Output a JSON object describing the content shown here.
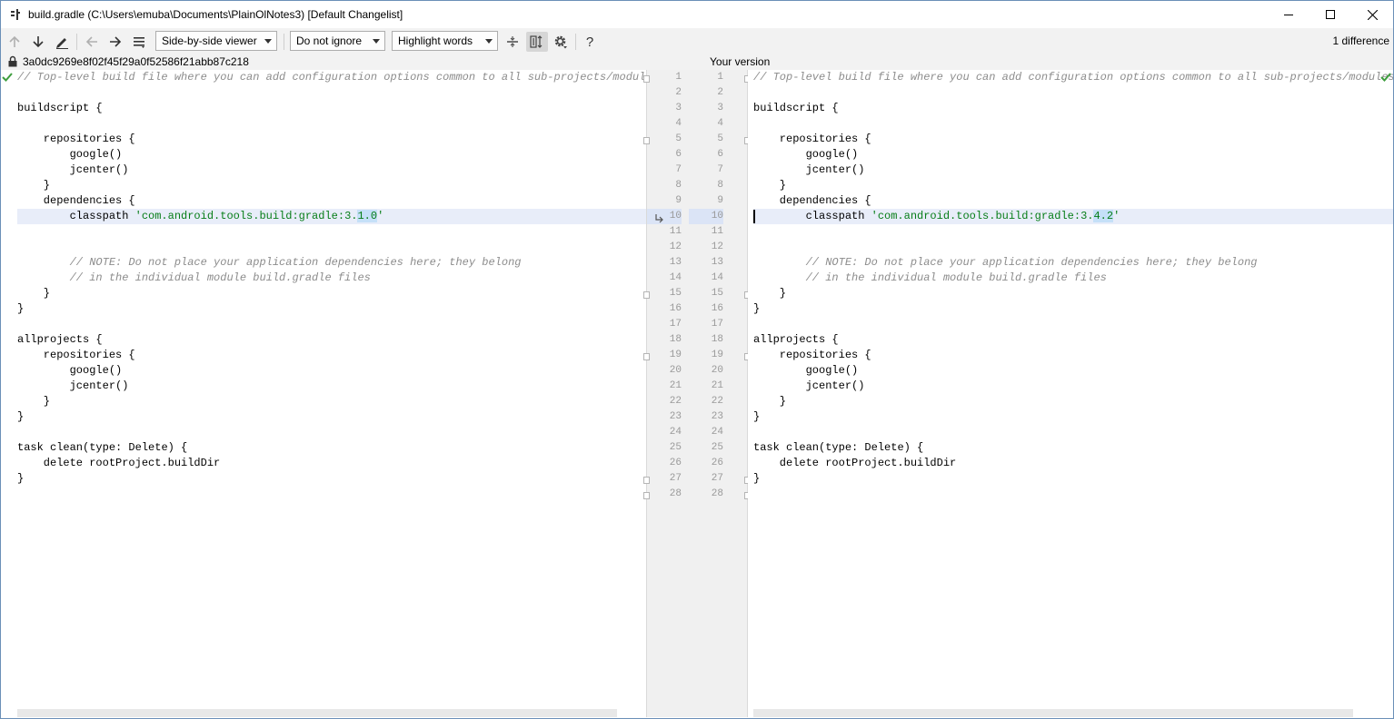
{
  "window": {
    "title": "build.gradle (C:\\Users\\emuba\\Documents\\PlainOlNotes3) [Default Changelist]",
    "minimize_icon": "minimize-icon",
    "maximize_icon": "maximize-icon",
    "close_icon": "close-icon"
  },
  "toolbar": {
    "viewer_select": "Side-by-side viewer",
    "ignore_select": "Do not ignore",
    "highlight_select": "Highlight words",
    "help_label": "?",
    "difference_count": "1 difference"
  },
  "header": {
    "left_revision": "3a0dc9269e8f02f45f29a0f52586f21abb87c218",
    "right_title": "Your version"
  },
  "left_code": [
    {
      "type": "comment",
      "text": "// Top-level build file where you can add configuration options common to all sub-projects/modules."
    },
    {
      "type": "plain",
      "text": ""
    },
    {
      "type": "plain",
      "text": "buildscript {"
    },
    {
      "type": "plain",
      "text": ""
    },
    {
      "type": "plain",
      "text": "    repositories {"
    },
    {
      "type": "plain",
      "text": "        google()"
    },
    {
      "type": "plain",
      "text": "        jcenter()"
    },
    {
      "type": "plain",
      "text": "    }"
    },
    {
      "type": "plain",
      "text": "    dependencies {"
    },
    {
      "type": "changed",
      "pre": "        classpath ",
      "str_pre": "'com.android.tools.build:gradle:3.",
      "str_chg": "1.0",
      "str_post": "'"
    },
    {
      "type": "plain",
      "text": ""
    },
    {
      "type": "plain",
      "text": ""
    },
    {
      "type": "comment",
      "text": "        // NOTE: Do not place your application dependencies here; they belong"
    },
    {
      "type": "comment",
      "text": "        // in the individual module build.gradle files"
    },
    {
      "type": "plain",
      "text": "    }"
    },
    {
      "type": "plain",
      "text": "}"
    },
    {
      "type": "plain",
      "text": ""
    },
    {
      "type": "plain",
      "text": "allprojects {"
    },
    {
      "type": "plain",
      "text": "    repositories {"
    },
    {
      "type": "plain",
      "text": "        google()"
    },
    {
      "type": "plain",
      "text": "        jcenter()"
    },
    {
      "type": "plain",
      "text": "    }"
    },
    {
      "type": "plain",
      "text": "}"
    },
    {
      "type": "plain",
      "text": ""
    },
    {
      "type": "task",
      "pre": "task clean(",
      "kw": "type",
      "post": ": Delete) {"
    },
    {
      "type": "plain",
      "text": "    delete rootProject.buildDir"
    },
    {
      "type": "plain",
      "text": "}"
    },
    {
      "type": "plain",
      "text": ""
    }
  ],
  "right_code": [
    {
      "type": "comment",
      "text": "// Top-level build file where you can add configuration options common to all sub-projects/modules."
    },
    {
      "type": "plain",
      "text": ""
    },
    {
      "type": "plain",
      "text": "buildscript {"
    },
    {
      "type": "plain",
      "text": ""
    },
    {
      "type": "plain",
      "text": "    repositories {"
    },
    {
      "type": "plain",
      "text": "        google()"
    },
    {
      "type": "plain",
      "text": "        jcenter()"
    },
    {
      "type": "plain",
      "text": "    }"
    },
    {
      "type": "plain",
      "text": "    dependencies {"
    },
    {
      "type": "changed",
      "pre": "        classpath ",
      "str_pre": "'com.android.tools.build:gradle:3.",
      "str_chg": "4.2",
      "str_post": "'"
    },
    {
      "type": "plain",
      "text": ""
    },
    {
      "type": "plain",
      "text": ""
    },
    {
      "type": "comment",
      "text": "        // NOTE: Do not place your application dependencies here; they belong"
    },
    {
      "type": "comment",
      "text": "        // in the individual module build.gradle files"
    },
    {
      "type": "plain",
      "text": "    }"
    },
    {
      "type": "plain",
      "text": "}"
    },
    {
      "type": "plain",
      "text": ""
    },
    {
      "type": "plain",
      "text": "allprojects {"
    },
    {
      "type": "plain",
      "text": "    repositories {"
    },
    {
      "type": "plain",
      "text": "        google()"
    },
    {
      "type": "plain",
      "text": "        jcenter()"
    },
    {
      "type": "plain",
      "text": "    }"
    },
    {
      "type": "plain",
      "text": "}"
    },
    {
      "type": "plain",
      "text": ""
    },
    {
      "type": "task",
      "pre": "task clean(",
      "kw": "type",
      "post": ": Delete) {"
    },
    {
      "type": "plain",
      "text": "    delete rootProject.buildDir"
    },
    {
      "type": "plain",
      "text": "}"
    },
    {
      "type": "plain",
      "text": ""
    }
  ],
  "line_numbers": [
    "1",
    "2",
    "3",
    "4",
    "5",
    "6",
    "7",
    "8",
    "9",
    "10",
    "11",
    "12",
    "13",
    "14",
    "15",
    "16",
    "17",
    "18",
    "19",
    "20",
    "21",
    "22",
    "23",
    "24",
    "25",
    "26",
    "27",
    "28"
  ],
  "changed_line_index": 9,
  "colors": {
    "comment": "#8c8c8c",
    "string": "#067d17",
    "changed_line_bg": "#e8edf9",
    "changed_word_bg": "#c5e0f8",
    "check": "#3e9e3e"
  }
}
